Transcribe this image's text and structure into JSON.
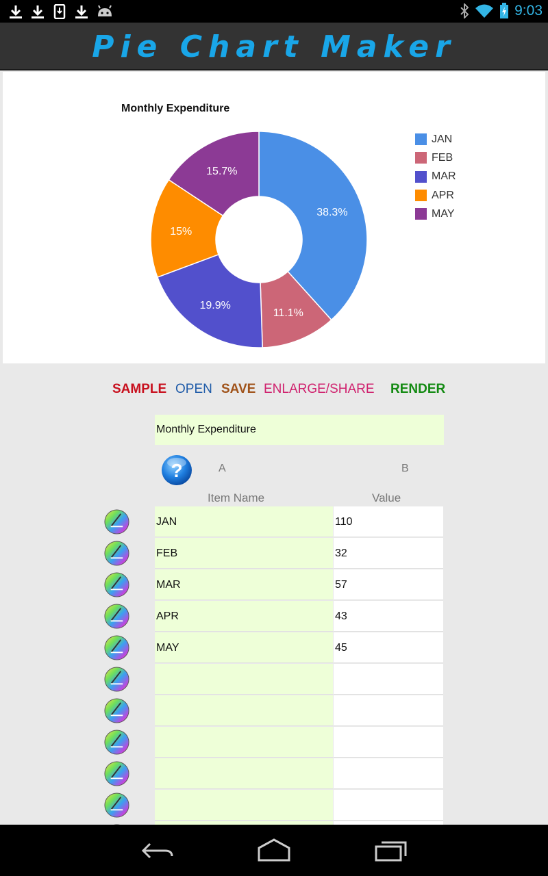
{
  "status_bar": {
    "time": "9:03",
    "left_icons": [
      "download-icon",
      "download-icon",
      "download-box-icon",
      "download-icon",
      "android-icon"
    ],
    "right_icons": [
      "bluetooth-icon",
      "wifi-icon",
      "battery-charging-icon"
    ]
  },
  "app": {
    "title": "Pie Chart Maker"
  },
  "chart_data": {
    "type": "pie",
    "title": "Monthly Expenditure",
    "donut": true,
    "categories": [
      "JAN",
      "FEB",
      "MAR",
      "APR",
      "MAY"
    ],
    "values": [
      110,
      32,
      57,
      43,
      45
    ],
    "labels": [
      "38.3%",
      "11.1%",
      "19.9%",
      "15%",
      "15.7%"
    ],
    "colors": [
      "#4a8fe6",
      "#cc6677",
      "#5250cc",
      "#fe8c00",
      "#8c3a95"
    ],
    "legend_position": "right"
  },
  "actions": {
    "sample": "SAMPLE",
    "open": "OPEN",
    "save": "SAVE",
    "enlarge": "ENLARGE/SHARE",
    "render": "RENDER",
    "colors": {
      "sample": "#c8101e",
      "open": "#1f5ba8",
      "save": "#a0531a",
      "enlarge": "#d0236f",
      "render": "#138a12"
    }
  },
  "form": {
    "title_value": "Monthly Expenditure",
    "col_a": "A",
    "col_b": "B",
    "header_name": "Item Name",
    "header_value": "Value",
    "help_icon": "help-icon",
    "row_icon": "color-picker-icon"
  },
  "rows": [
    {
      "name": "JAN",
      "value": "110"
    },
    {
      "name": "FEB",
      "value": "32"
    },
    {
      "name": "MAR",
      "value": "57"
    },
    {
      "name": "APR",
      "value": "43"
    },
    {
      "name": "MAY",
      "value": "45"
    },
    {
      "name": "",
      "value": ""
    },
    {
      "name": "",
      "value": ""
    },
    {
      "name": "",
      "value": ""
    },
    {
      "name": "",
      "value": ""
    },
    {
      "name": "",
      "value": ""
    },
    {
      "name": "",
      "value": ""
    }
  ],
  "nav_bar": {
    "buttons": [
      "back-icon",
      "home-icon",
      "recent-apps-icon"
    ]
  }
}
